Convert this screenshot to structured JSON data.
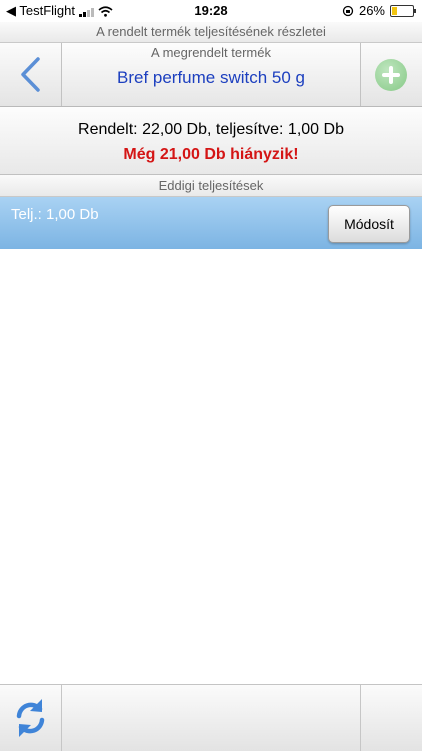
{
  "statusbar": {
    "back_app": "◀ TestFlight",
    "time": "19:28",
    "battery": "26%"
  },
  "header": {
    "title": "A rendelt termék teljesítésének részletei"
  },
  "product": {
    "caption": "A megrendelt termék",
    "name": "Bref perfume switch 50 g"
  },
  "summary": {
    "ordered_line": "Rendelt: 22,00 Db, teljesítve: 1,00 Db",
    "missing_line": "Még 21,00 Db hiányzik!"
  },
  "section": {
    "title": "Eddigi teljesítések"
  },
  "fulfillments": [
    {
      "text": "Telj.: 1,00 Db",
      "button": "Módosít"
    }
  ],
  "icons": {
    "back": "chevron-left-icon",
    "add": "plus-circle-icon",
    "refresh": "refresh-icon"
  },
  "colors": {
    "accent_blue": "#1c3fbf",
    "missing_red": "#d41515",
    "row_blue": "#7cb4e3",
    "add_green": "#86c986"
  }
}
